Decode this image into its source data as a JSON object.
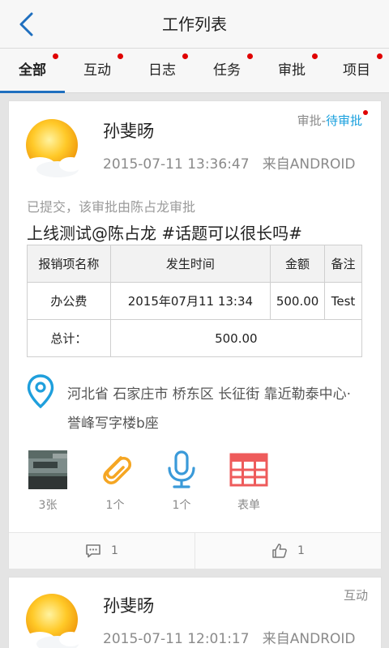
{
  "header": {
    "title": "工作列表",
    "back_icon": "chevron-left-icon"
  },
  "tabs": [
    {
      "label": "全部",
      "active": true,
      "has_dot": true
    },
    {
      "label": "互动",
      "active": false,
      "has_dot": true
    },
    {
      "label": "日志",
      "active": false,
      "has_dot": true
    },
    {
      "label": "任务",
      "active": false,
      "has_dot": true
    },
    {
      "label": "审批",
      "active": false,
      "has_dot": true
    },
    {
      "label": "项目",
      "active": false,
      "has_dot": true
    }
  ],
  "colors": {
    "accent": "#1f6fbf",
    "status_blue": "#1aa0de",
    "dot_red": "#e00000",
    "clip_orange": "#f5a623",
    "mic_blue": "#3a9ad9",
    "form_red": "#ee5b5b"
  },
  "posts": [
    {
      "author": "孙斐旸",
      "time": "2015-07-11 13:36:47",
      "source": "来自ANDROID",
      "type_prefix": "审批-",
      "type_status": "待审批",
      "submitted": "已提交，该审批由陈占龙审批",
      "title": "上线测试@陈占龙 #话题可以很长吗#",
      "table": {
        "headers": [
          "报销项名称",
          "发生时间",
          "金额",
          "备注"
        ],
        "row": [
          "办公费",
          "2015年07月11 13:34",
          "500.00",
          "Test"
        ],
        "total_label": "总计：",
        "total_value": "500.00"
      },
      "location_line1": "河北省 石家庄市 桥东区 长征街 靠近勒泰中心·",
      "location_line2": "誉峰写字楼b座",
      "attachments": [
        {
          "icon": "photo-thumbnail-icon",
          "caption": "3张"
        },
        {
          "icon": "paperclip-icon",
          "caption": "1个"
        },
        {
          "icon": "microphone-icon",
          "caption": "1个"
        },
        {
          "icon": "form-grid-icon",
          "caption": "表单"
        }
      ],
      "comments": "1",
      "likes": "1"
    },
    {
      "author": "孙斐旸",
      "time": "2015-07-11 12:01:17",
      "source": "来自ANDROID",
      "type_label": "互动"
    }
  ]
}
